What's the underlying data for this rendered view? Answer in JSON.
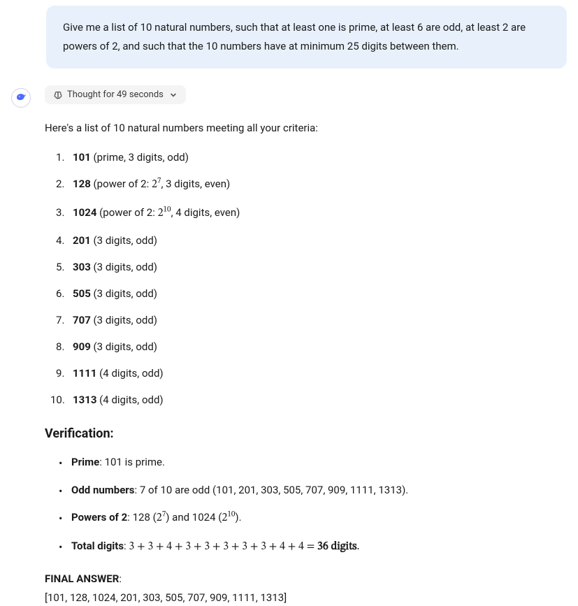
{
  "user_message": "Give me a list of 10 natural numbers, such that at least one is prime, at least 6 are odd, at least 2 are powers of 2, and such that the 10 numbers have at minimum 25 digits between them.",
  "thought": {
    "label": "Thought for 49 seconds"
  },
  "intro": "Here's a list of 10 natural numbers meeting all your criteria:",
  "items": [
    {
      "num": "101",
      "desc": " (prime, 3 digits, odd)",
      "power_base": "",
      "power_exp": "",
      "desc2": ""
    },
    {
      "num": "128",
      "desc": " (power of 2: ",
      "power_base": "2",
      "power_exp": "7",
      "desc2": ", 3 digits, even)"
    },
    {
      "num": "1024",
      "desc": " (power of 2: ",
      "power_base": "2",
      "power_exp": "10",
      "desc2": ", 4 digits, even)"
    },
    {
      "num": "201",
      "desc": " (3 digits, odd)",
      "power_base": "",
      "power_exp": "",
      "desc2": ""
    },
    {
      "num": "303",
      "desc": " (3 digits, odd)",
      "power_base": "",
      "power_exp": "",
      "desc2": ""
    },
    {
      "num": "505",
      "desc": " (3 digits, odd)",
      "power_base": "",
      "power_exp": "",
      "desc2": ""
    },
    {
      "num": "707",
      "desc": " (3 digits, odd)",
      "power_base": "",
      "power_exp": "",
      "desc2": ""
    },
    {
      "num": "909",
      "desc": " (3 digits, odd)",
      "power_base": "",
      "power_exp": "",
      "desc2": ""
    },
    {
      "num": "1111",
      "desc": " (4 digits, odd)",
      "power_base": "",
      "power_exp": "",
      "desc2": ""
    },
    {
      "num": "1313",
      "desc": " (4 digits, odd)",
      "power_base": "",
      "power_exp": "",
      "desc2": ""
    }
  ],
  "verification_heading": "Verification:",
  "verify": {
    "prime_label": "Prime",
    "prime_text": ": 101 is prime.",
    "odd_label": "Odd numbers",
    "odd_text": ": 7 of 10 are odd (101, 201, 303, 505, 707, 909, 1111, 1313).",
    "powers_label": "Powers of 2",
    "powers_prefix": ": 128 (",
    "powers_b1": "2",
    "powers_e1": "7",
    "powers_mid": ") and 1024 (",
    "powers_b2": "2",
    "powers_e2": "10",
    "powers_suffix": ").",
    "digits_label": "Total digits",
    "digits_prefix": ": ",
    "digits_sum": "3 + 3 + 4 + 3 + 3 + 3 + 3 + 3 + 4 + 4 = ",
    "digits_result": "36 digits",
    "digits_period": "."
  },
  "final_label": "FINAL ANSWER",
  "final_colon": ":",
  "final_array": "[101, 128, 1024, 201, 303, 505, 707, 909, 1111, 1313]"
}
